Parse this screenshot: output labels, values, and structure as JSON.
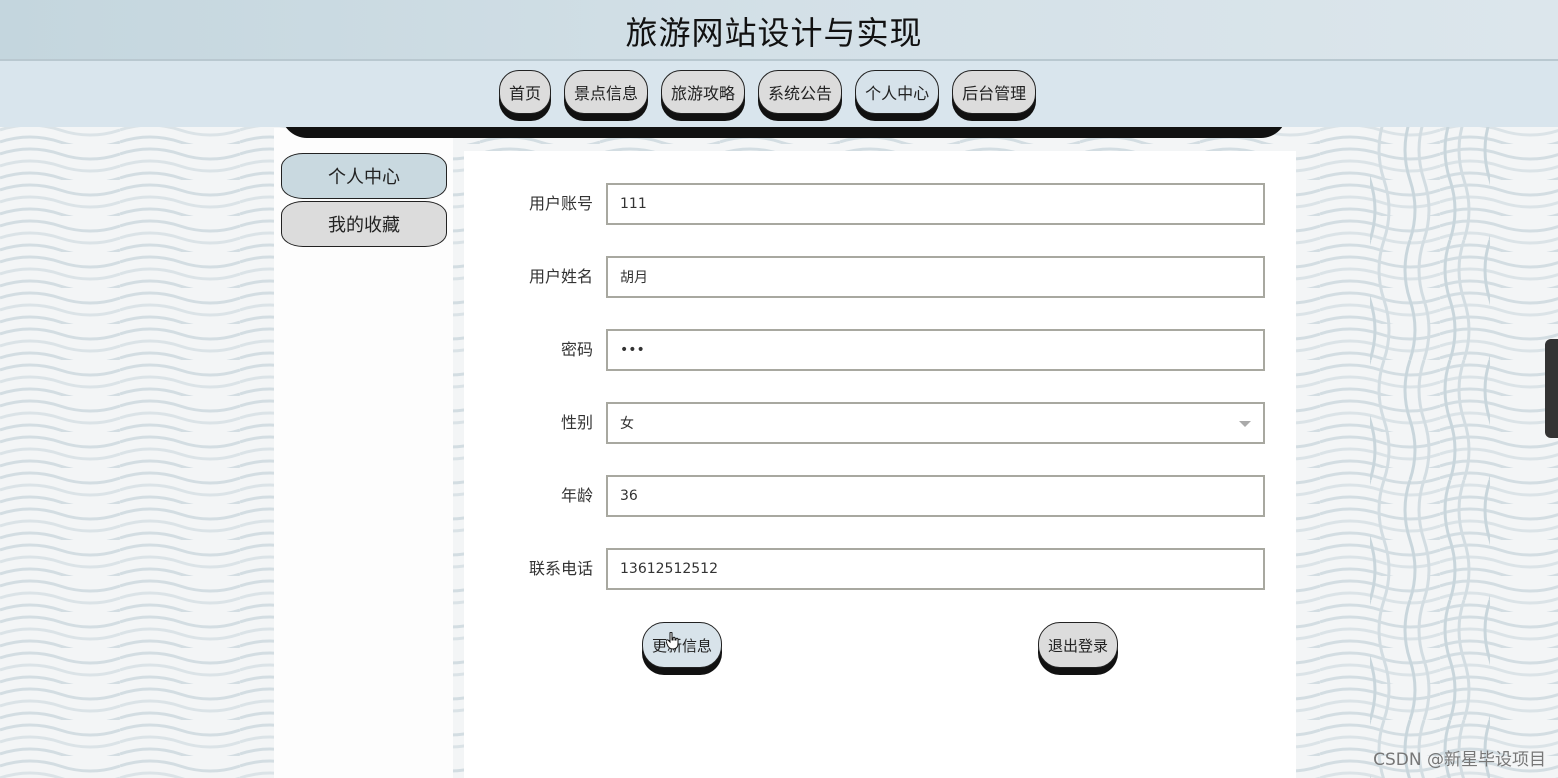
{
  "site": {
    "title": "旅游网站设计与实现"
  },
  "nav": {
    "items": [
      {
        "label": "首页",
        "active": false
      },
      {
        "label": "景点信息",
        "active": false
      },
      {
        "label": "旅游攻略",
        "active": false
      },
      {
        "label": "系统公告",
        "active": false
      },
      {
        "label": "个人中心",
        "active": true
      },
      {
        "label": "后台管理",
        "active": false
      }
    ]
  },
  "sidebar": {
    "items": [
      {
        "label": "个人中心",
        "active": true
      },
      {
        "label": "我的收藏",
        "active": false
      }
    ]
  },
  "form": {
    "account": {
      "label": "用户账号",
      "value": "111"
    },
    "name": {
      "label": "用户姓名",
      "value": "胡月"
    },
    "password": {
      "label": "密码",
      "value": "111"
    },
    "gender": {
      "label": "性别",
      "value": "女"
    },
    "age": {
      "label": "年龄",
      "value": "36"
    },
    "phone": {
      "label": "联系电话",
      "value": "13612512512"
    }
  },
  "actions": {
    "update_label": "更新信息",
    "logout_label": "退出登录"
  },
  "watermark": "CSDN @新星毕设项目",
  "colors": {
    "header_bg": "#c4d6de",
    "nav_bg": "#d9e5ed",
    "button_bg": "#dcdcdc",
    "active_bg": "#c9d9e0",
    "button_shadow": "#111111"
  },
  "icons": {
    "cursor": "hand-pointer-icon",
    "dropdown": "chevron-down-icon"
  }
}
